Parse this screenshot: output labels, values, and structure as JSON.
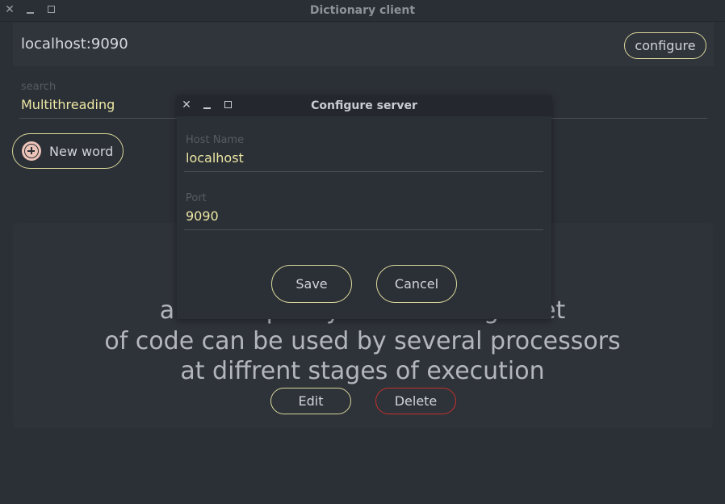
{
  "window": {
    "title": "Dictionary client",
    "close_glyph": "✕"
  },
  "server_bar": {
    "address": "localhost:9090",
    "configure_label": "configure"
  },
  "search": {
    "label": "search",
    "value": "Multithreading"
  },
  "new_word": {
    "label": "New word",
    "icon": "plus-circle-icon"
  },
  "definition": {
    "line1": "a technique by which a single set",
    "line2": "of code can be used by several processors",
    "line3": "at diffrent stages of execution",
    "edit_label": "Edit",
    "delete_label": "Delete"
  },
  "dialog": {
    "title": "Configure server",
    "close_glyph": "✕",
    "host_label": "Host Name",
    "host_value": "localhost",
    "port_label": "Port",
    "port_value": "9090",
    "save_label": "Save",
    "cancel_label": "Cancel"
  },
  "colors": {
    "background": "#2b2f36",
    "accent_outline": "#d7d79a",
    "input_text": "#ebe7a3",
    "danger_outline": "#c4322c",
    "plus_icon": "#ecc3b8"
  }
}
